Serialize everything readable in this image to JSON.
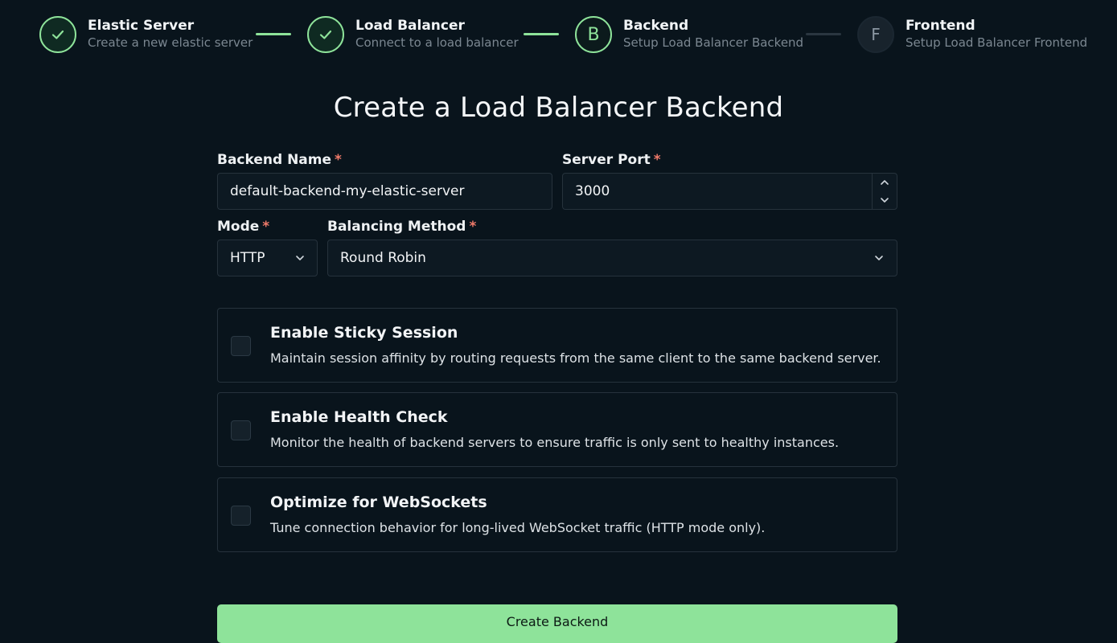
{
  "stepper": {
    "steps": [
      {
        "title": "Elastic Server",
        "subtitle": "Create a new elastic server",
        "state": "done",
        "icon": "check-icon"
      },
      {
        "title": "Load Balancer",
        "subtitle": "Connect to a load balancer",
        "state": "done",
        "icon": "check-icon"
      },
      {
        "title": "Backend",
        "subtitle": "Setup Load Balancer Backend",
        "state": "active",
        "letter": "B"
      },
      {
        "title": "Frontend",
        "subtitle": "Setup Load Balancer Frontend",
        "state": "pending",
        "letter": "F"
      }
    ]
  },
  "form": {
    "title": "Create a Load Balancer Backend",
    "required_mark": "*",
    "backend_name": {
      "label": "Backend Name",
      "value": "default-backend-my-elastic-server"
    },
    "server_port": {
      "label": "Server Port",
      "value": "3000"
    },
    "mode": {
      "label": "Mode",
      "value": "HTTP"
    },
    "balancing_method": {
      "label": "Balancing Method",
      "value": "Round Robin"
    },
    "options": [
      {
        "title": "Enable Sticky Session",
        "description": "Maintain session affinity by routing requests from the same client to the same backend server.",
        "checked": false
      },
      {
        "title": "Enable Health Check",
        "description": "Monitor the health of backend servers to ensure traffic is only sent to healthy instances.",
        "checked": false
      },
      {
        "title": "Optimize for WebSockets",
        "description": "Tune connection behavior for long-lived WebSocket traffic (HTTP mode only).",
        "checked": false
      }
    ],
    "submit_label": "Create Backend"
  },
  "colors": {
    "background": "#09141c",
    "accent": "#8ee39a",
    "required": "#f07a6a"
  }
}
